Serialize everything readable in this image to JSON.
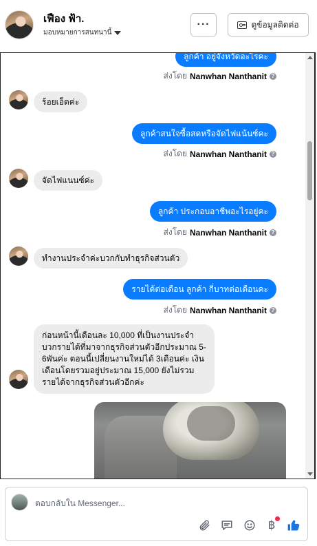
{
  "header": {
    "contact_name": "เฟือง ฟ้า.",
    "assign_label": "มอบหมายการสนทนานี้",
    "more_label": "···",
    "contact_info_label": "ดูข้อมูลติดต่อ"
  },
  "messages": [
    {
      "dir": "out",
      "text": "ลูกค้า อยู่จังหวัดอะไรคะ"
    },
    {
      "dir": "in",
      "text": "ร้อยเอ็ดค่ะ"
    },
    {
      "dir": "out",
      "text": "ลูกค้าสนใจซื้อสดหรือจัดไฟแน้นซ์คะ"
    },
    {
      "dir": "in",
      "text": "จัดไฟแนนซ์ค่ะ"
    },
    {
      "dir": "out",
      "text": "ลูกค้า ประกอบอาชีพอะไรอยู่คะ"
    },
    {
      "dir": "in",
      "text": "ทำงานประจำค่ะบวกกับทำธุรกิจส่วนตัว"
    },
    {
      "dir": "out",
      "text": "รายได้ต่อเดือน ลูกค้า กี่บาทต่อเดือนคะ"
    },
    {
      "dir": "in",
      "text": "ก่อนหน้านี้เดือนละ 10,000 ที่เป็นงานประจำ บวกรายได้ที่มาจากธุรกิจส่วนตัวอีกประมาณ 5-6พันค่ะ ตอนนี้เปลี่ยนงานใหม่ได้ 3เดือนค่ะ เงินเดือนโดยรวมอยู่ประมาณ 15,000 ยังไม่รวมรายได้จากธุรกิจส่วนตัวอีกค่ะ"
    }
  ],
  "sent_by": {
    "prefix": "ส่งโดย",
    "agent": "Nanwhan Nanthanit",
    "help": "?"
  },
  "composer": {
    "placeholder": "ตอบกลับใน Messenger..."
  },
  "toolbar": {
    "baht_symbol": "฿"
  },
  "colors": {
    "outgoing_bubble": "#0a7cff",
    "incoming_bubble": "#ececec",
    "like_icon": "#1b74e4",
    "notification_dot": "#f02849"
  }
}
